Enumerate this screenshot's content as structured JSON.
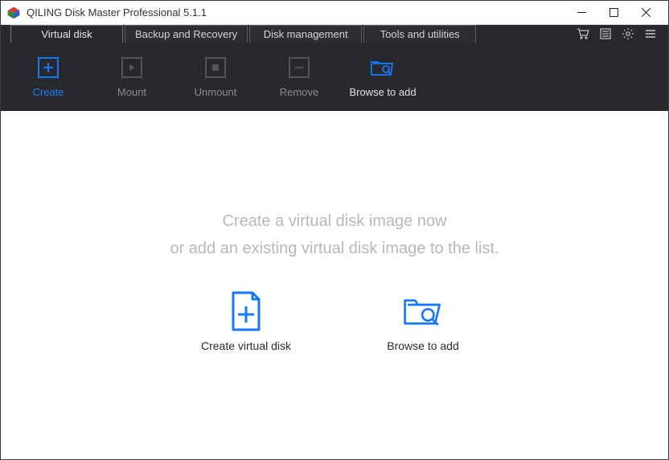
{
  "window": {
    "title": "QILING Disk Master Professional 5.1.1"
  },
  "tabs": [
    {
      "label": "Virtual disk",
      "active": true
    },
    {
      "label": "Backup and Recovery",
      "active": false
    },
    {
      "label": "Disk management",
      "active": false
    },
    {
      "label": "Tools and utilities",
      "active": false
    }
  ],
  "right_icons": [
    {
      "name": "cart-icon"
    },
    {
      "name": "list-icon"
    },
    {
      "name": "gear-icon"
    },
    {
      "name": "menu-icon"
    }
  ],
  "toolbar": [
    {
      "name": "create",
      "label": "Create",
      "state": "active"
    },
    {
      "name": "mount",
      "label": "Mount",
      "state": "disabled"
    },
    {
      "name": "unmount",
      "label": "Unmount",
      "state": "disabled"
    },
    {
      "name": "remove",
      "label": "Remove",
      "state": "disabled"
    },
    {
      "name": "browse",
      "label": "Browse to add",
      "state": "browse"
    }
  ],
  "main": {
    "headline_line1": "Create a virtual disk image now",
    "headline_line2": "or add an existing virtual disk image to the list.",
    "actions": [
      {
        "name": "create-virtual-disk",
        "label": "Create virtual disk"
      },
      {
        "name": "browse-to-add",
        "label": "Browse to add"
      }
    ]
  },
  "colors": {
    "accent": "#1677ff",
    "dark_bg": "#27292d",
    "muted_text": "#b8b8b8"
  }
}
